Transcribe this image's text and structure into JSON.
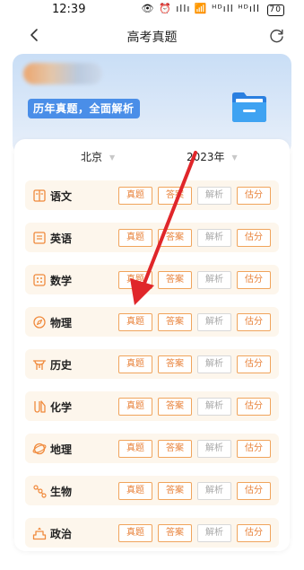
{
  "status_bar": {
    "time": "12:39",
    "icons": "👁 ⏰ ıllı 📶 ᴴᴰıll ᴴᴰıll",
    "battery": "70"
  },
  "nav": {
    "title": "高考真题",
    "back_icon": "chevron-left-icon",
    "refresh_icon": "refresh-icon"
  },
  "hero": {
    "slogan": "历年真题，全面解析"
  },
  "filters": {
    "region": "北京",
    "year": "2023年"
  },
  "subjects": [
    {
      "name": "语文",
      "icon": "book-icon",
      "tags": [
        "真题",
        "答案",
        "解析",
        "估分"
      ]
    },
    {
      "name": "英语",
      "icon": "document-icon",
      "tags": [
        "真题",
        "答案",
        "解析",
        "估分"
      ]
    },
    {
      "name": "数学",
      "icon": "calculator-icon",
      "tags": [
        "真题",
        "答案",
        "解析",
        "估分"
      ]
    },
    {
      "name": "物理",
      "icon": "compass-icon",
      "tags": [
        "真题",
        "答案",
        "解析",
        "估分"
      ]
    },
    {
      "name": "历史",
      "icon": "monument-icon",
      "tags": [
        "真题",
        "答案",
        "解析",
        "估分"
      ]
    },
    {
      "name": "化学",
      "icon": "flask-icon",
      "tags": [
        "真题",
        "答案",
        "解析",
        "估分"
      ]
    },
    {
      "name": "地理",
      "icon": "globe-icon",
      "tags": [
        "真题",
        "答案",
        "解析",
        "估分"
      ]
    },
    {
      "name": "生物",
      "icon": "molecule-icon",
      "tags": [
        "真题",
        "答案",
        "解析",
        "估分"
      ]
    },
    {
      "name": "政治",
      "icon": "podium-icon",
      "tags": [
        "真题",
        "答案",
        "解析",
        "估分"
      ]
    }
  ],
  "colors": {
    "accent_orange": "#e8823a",
    "slogan_blue": "#4a8ee8",
    "annotation_red": "#e0262a"
  }
}
